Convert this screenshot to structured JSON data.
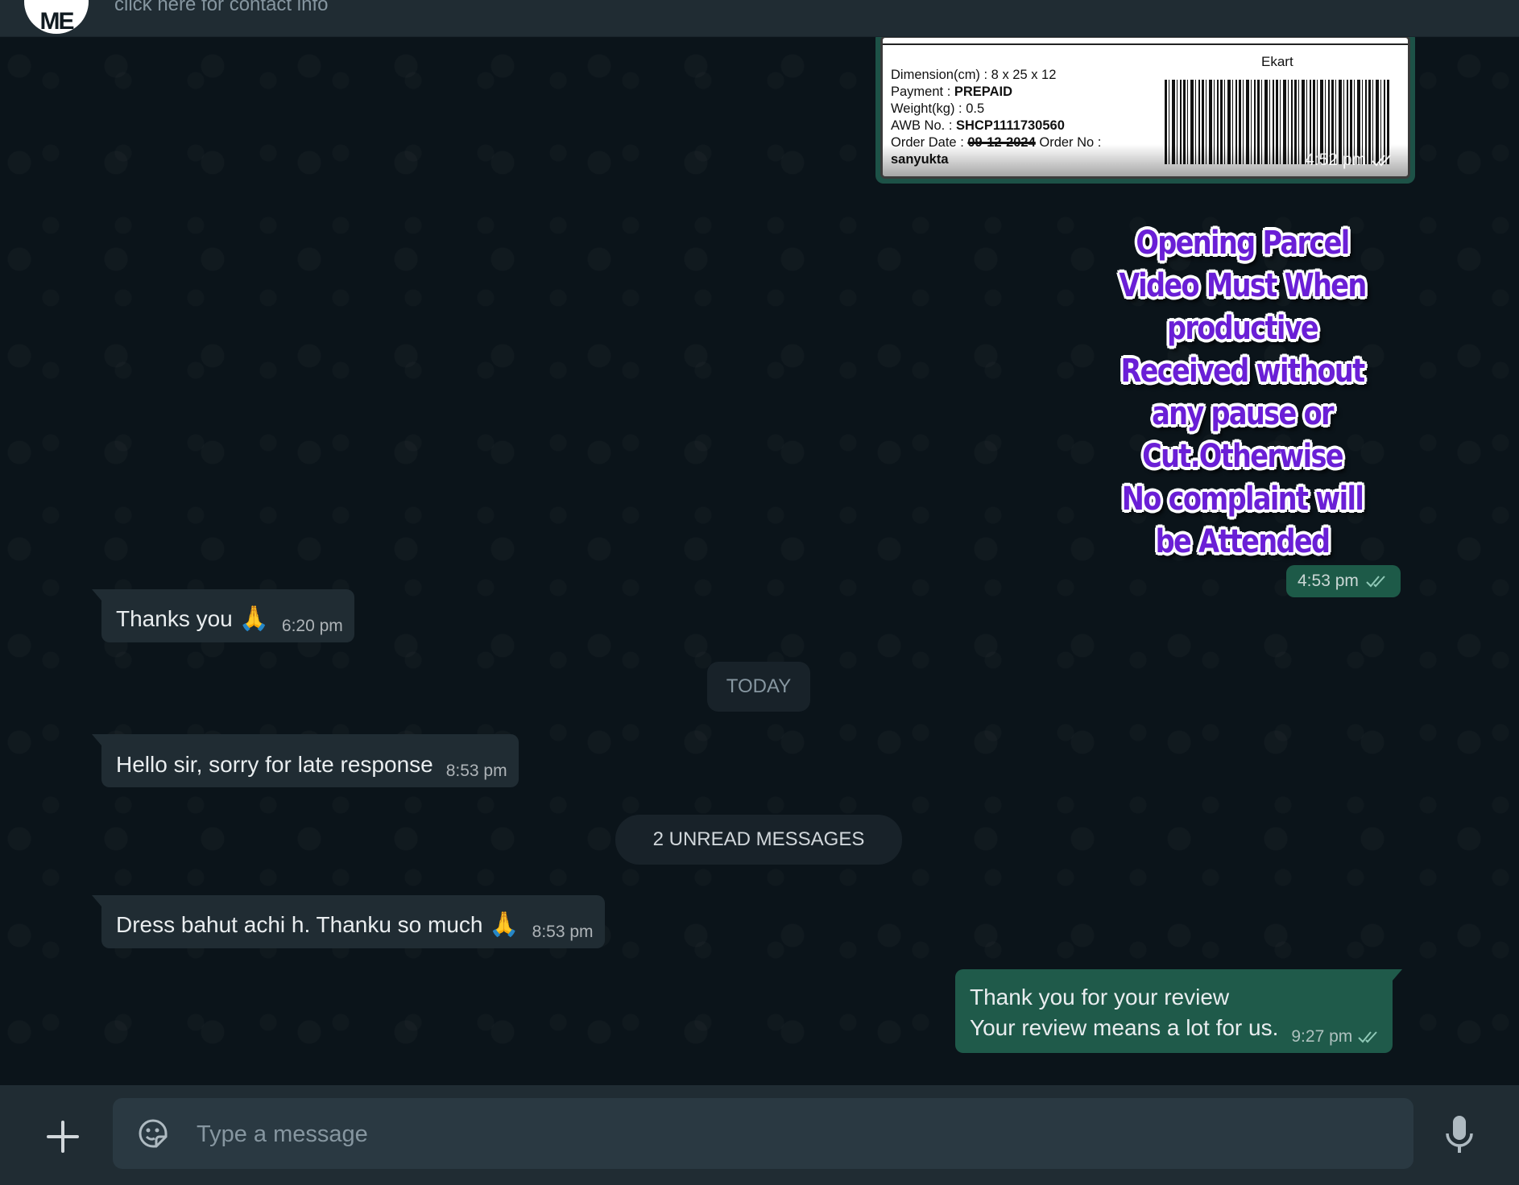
{
  "header": {
    "avatar_text": "ME",
    "subtitle": "click here for contact info"
  },
  "label_image": {
    "lines": {
      "dimension": "Dimension(cm) : 8 x 25 x 12",
      "payment_prefix": "Payment : ",
      "payment_value": "PREPAID",
      "weight": "Weight(kg) : 0.5",
      "awb_prefix": "AWB No. : ",
      "awb_value": "SHCP1111730560",
      "order_date_prefix": "Order Date : ",
      "order_date_value": "09-12-2024",
      "order_no": " Order No :",
      "name": "sanyukta"
    },
    "courier": "Ekart",
    "time": "4:52 pm"
  },
  "sticker": {
    "text": "Opening Parcel Video Must When productive Received without any pause or Cut.Otherwise No complaint will be Attended",
    "time": "4:53 pm"
  },
  "messages": [
    {
      "direction": "in",
      "text": "Thanks you",
      "emoji": "🙏",
      "time": "6:20 pm"
    },
    {
      "direction": "in",
      "text": "Hello sir, sorry for late response",
      "time": "8:53 pm"
    },
    {
      "direction": "in",
      "text": "Dress bahut achi h. Thanku so much",
      "emoji": "🙏",
      "time": "8:53 pm"
    },
    {
      "direction": "out",
      "line1": "Thank you for your review",
      "line2": "Your review means a lot for us.",
      "time": "9:27 pm"
    }
  ],
  "dividers": {
    "date": "TODAY",
    "unread": "2 UNREAD MESSAGES"
  },
  "composer": {
    "placeholder": "Type a message"
  },
  "icons": {
    "attach": "plus-icon",
    "sticker": "sticker-icon",
    "mic": "mic-icon",
    "read_receipt": "double-check-icon"
  },
  "colors": {
    "background": "#0b141a",
    "incoming_bubble": "#202c33",
    "outgoing_bubble": "#1f5a4a",
    "sticker_text": "#6a1fd6"
  }
}
